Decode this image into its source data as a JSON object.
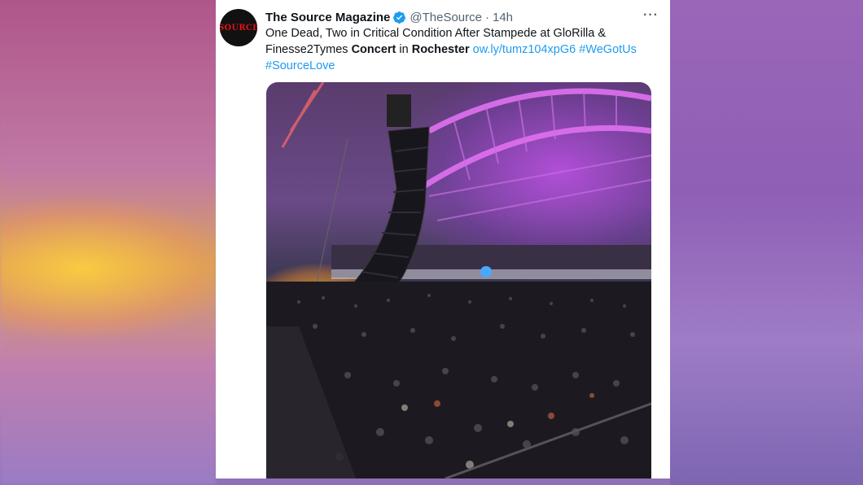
{
  "tweet": {
    "name": "The Source Magazine",
    "handle": "@TheSource",
    "separator": "·",
    "time": "14h",
    "more": "···",
    "avatar_text": "SOURCE",
    "text_1": "One Dead, Two in Critical Condition After Stampede at GloRilla & Finesse2Tymes ",
    "bold_1": "Concert",
    "text_2": " in ",
    "bold_2": "Rochester",
    "text_3": " ",
    "link": "ow.ly/tumz104xpG6",
    "hashtag_1": "#WeGotUs",
    "hashtag_2": "#SourceLove"
  },
  "colors": {
    "link": "#1d9bf0",
    "verified": "#1d9bf0",
    "text": "#0f1419",
    "muted": "#536471",
    "brand": "#e10f17"
  },
  "media": {
    "type": "photo",
    "content": "concert arena crowd with line array speaker and purple stage lights"
  }
}
